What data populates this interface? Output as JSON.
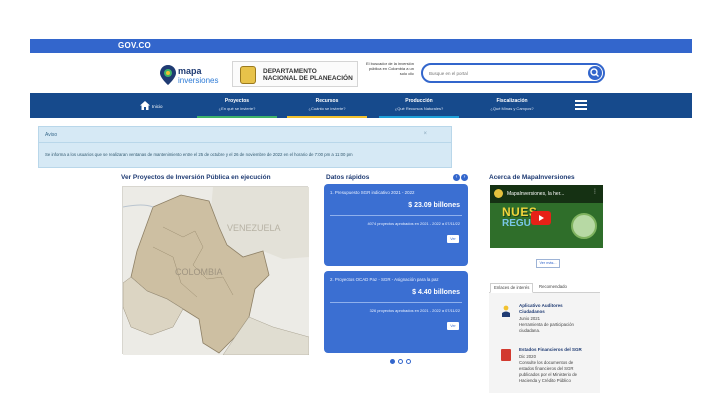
{
  "gov": {
    "logo": "GOV.CO"
  },
  "header": {
    "brand_line1": "mapa",
    "brand_line2": "inversiones",
    "dnp_line1": "DEPARTAMENTO",
    "dnp_line2": "NACIONAL DE PLANEACIÓN",
    "buscador_text": "El buscador de la inversión pública en Colombia a un solo clic",
    "search_placeholder": "Busque en el portal"
  },
  "nav": {
    "home_label": "Inicio",
    "items": [
      {
        "title": "Proyectos",
        "subtitle": "¿En qué se invierte?",
        "color": "#3fb36a"
      },
      {
        "title": "Recursos",
        "subtitle": "¿Cuánto se invierte?",
        "color": "#f2c230"
      },
      {
        "title": "Producción",
        "subtitle": "¿Qué Recursos Naturales?",
        "color": "#1fa0d9"
      },
      {
        "title": "Fiscalización",
        "subtitle": "¿Qué Minas y Campos?",
        "color": "#164a8c"
      }
    ]
  },
  "alert": {
    "title": "Aviso",
    "close": "×",
    "body": "Se informa a los usuarios que se realizaran ventanas de mantenimiento entre el 25 de octubre y el 26 de noviembre de 2022 en el horario de 7:00 pm a 11:00 pm"
  },
  "map_section": {
    "title": "Ver Proyectos de Inversión Pública en ejecución",
    "label_venezuela": "VENEZUELA",
    "label_colombia": "COLOMBIA"
  },
  "datos": {
    "title": "Datos rápidos",
    "prev": "‹",
    "next": "›",
    "cards": [
      {
        "title": "1. Presupuesto SGR indicativo 2021 - 2022",
        "value": "$ 23.09 billones",
        "subtitle": "4074 proyectos aprobados en 2021 - 2022 a 07/11/22",
        "button": "Ver"
      },
      {
        "title": "2. Proyectos OCAD Paz - SGR - Asignación para la paz",
        "value": "$ 4.40 billones",
        "subtitle": "326 proyectos aprobados en 2021 - 2022 a 07/11/22",
        "button": "Ver"
      }
    ]
  },
  "acerca": {
    "title": "Acerca de MapaInversiones",
    "video_title": "MapaInversiones, la her...",
    "video_text1": "NUES",
    "video_text2": "REGU",
    "ver_mas": "Ver más..."
  },
  "tabs": {
    "tab1": "Enlaces de interés",
    "tab2": "Recomendado",
    "items": [
      {
        "title1": "Aplicativo Auditores",
        "title2": "Ciudadanos",
        "lines": [
          "Junio 2021",
          "Herramienta de participación",
          "ciudadana."
        ]
      },
      {
        "title1": "Estados Financieros del SGR",
        "title2": "",
        "lines": [
          "Dic 2020",
          "Consulte los documentos de",
          "estados financieros del SGR",
          "publicados por el Ministerio de",
          "Hacienda y Crédito Público"
        ]
      }
    ]
  }
}
